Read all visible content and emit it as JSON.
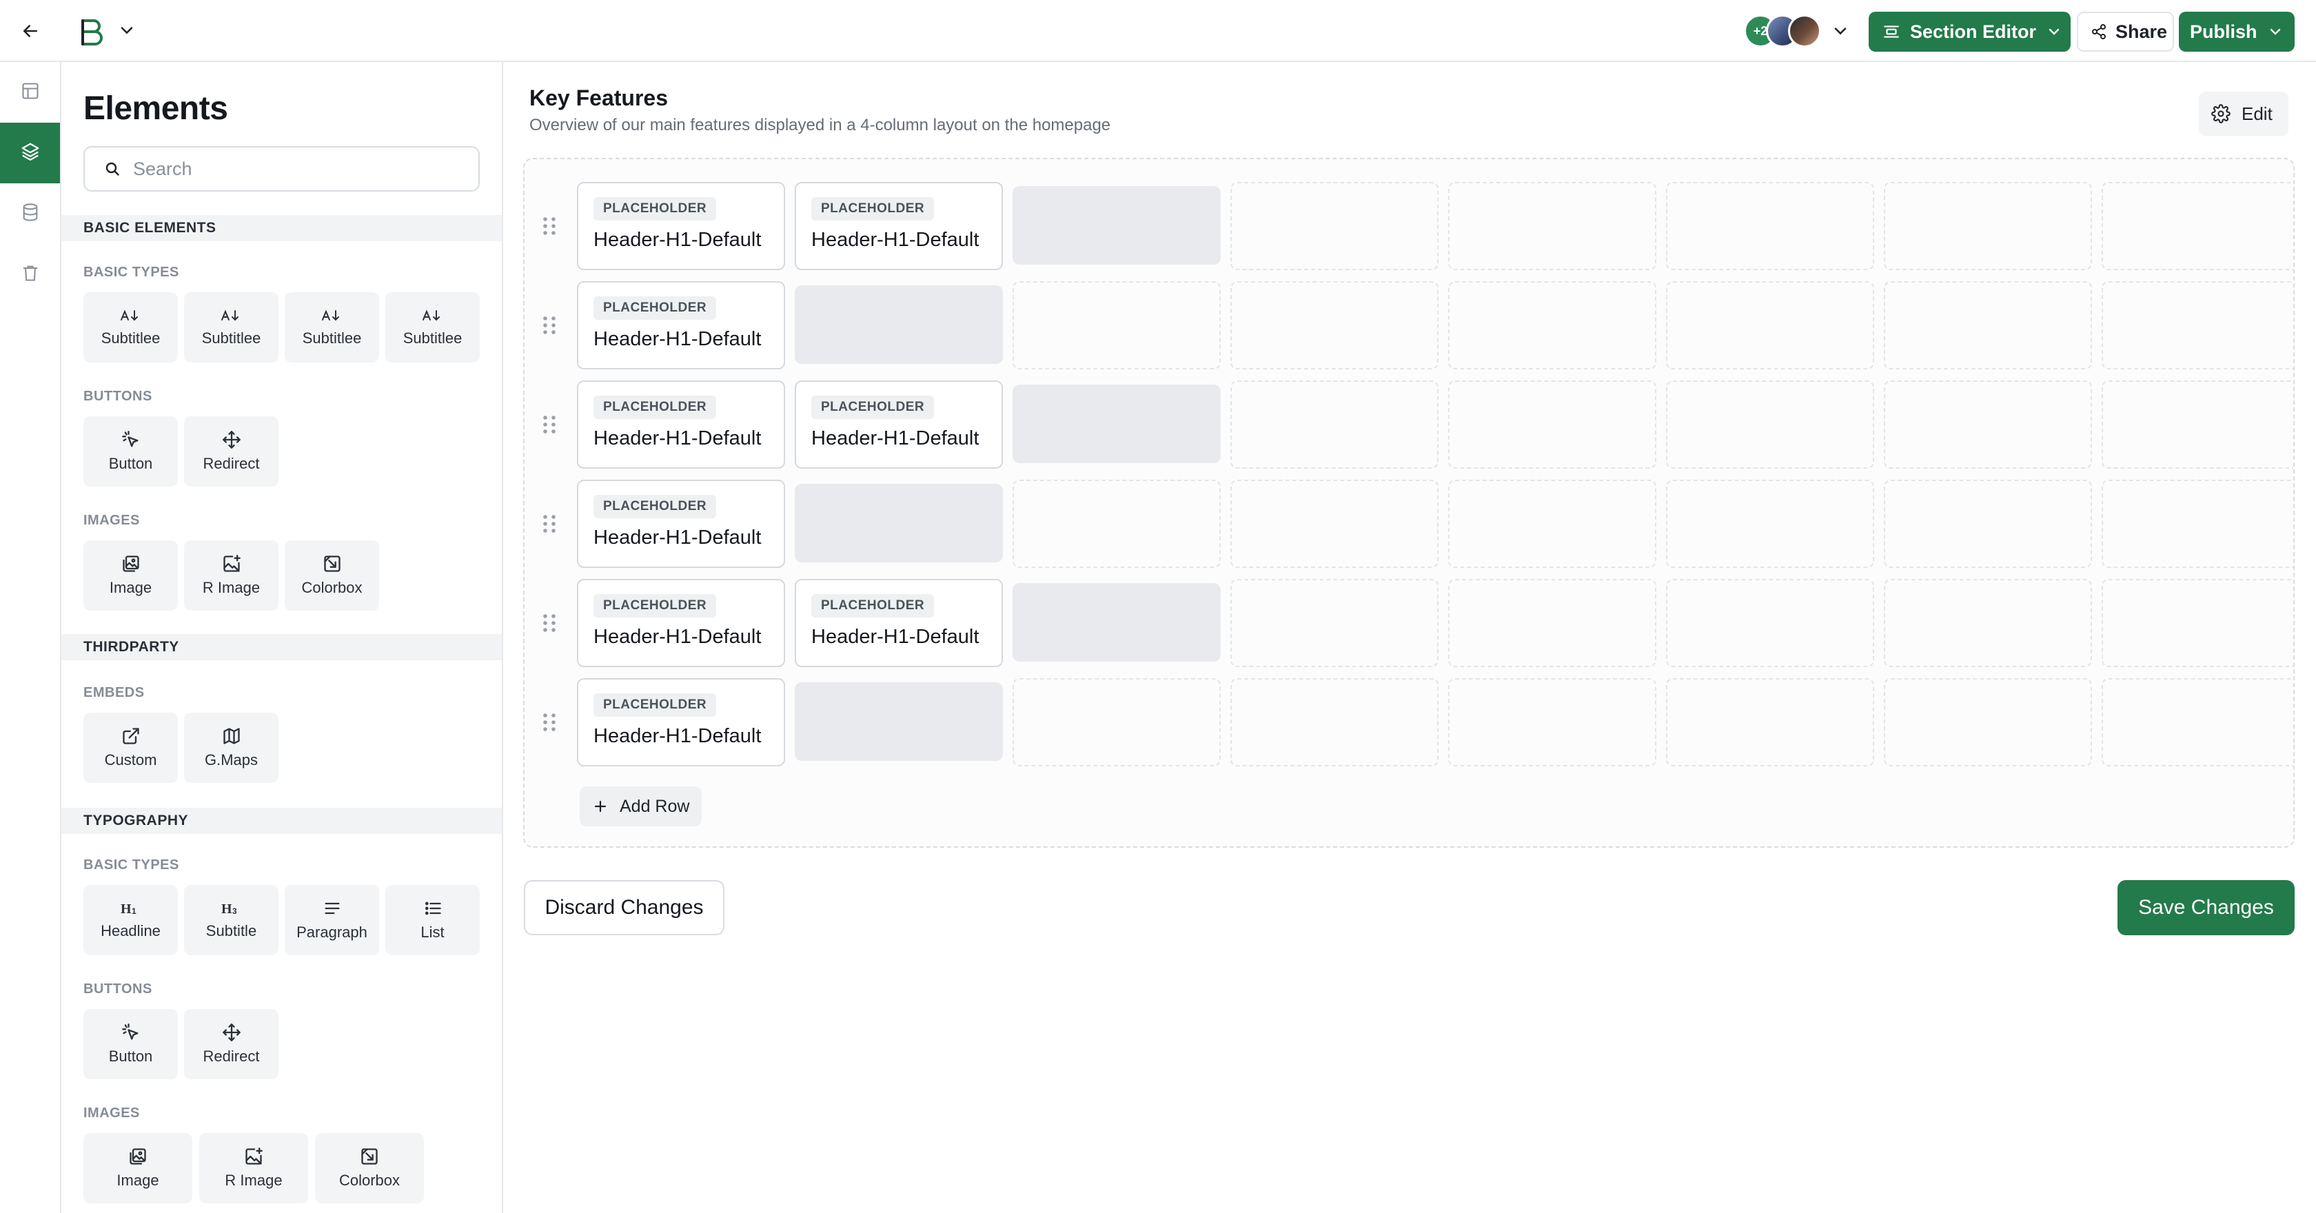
{
  "topbar": {
    "back_icon": "arrow-left-icon",
    "logo": "brand-logo",
    "collaborators": {
      "extra_count": "+2"
    },
    "section_editor_label": "Section Editor",
    "share_label": "Share",
    "publish_label": "Publish"
  },
  "rail": {
    "items": [
      {
        "icon": "layout-icon",
        "active": false
      },
      {
        "icon": "layers-icon",
        "active": true
      },
      {
        "icon": "database-icon",
        "active": false
      },
      {
        "icon": "trash-icon",
        "active": false
      }
    ]
  },
  "panel": {
    "title": "Elements",
    "search_placeholder": "Search",
    "sections": [
      {
        "label": "BASIC ELEMENTS",
        "groups": [
          {
            "label": "BASIC TYPES",
            "tiles": [
              "Subtitlee",
              "Subtitlee",
              "Subtitlee",
              "Subtitlee"
            ]
          },
          {
            "label": "BUTTONS",
            "tiles": [
              "Button",
              "Redirect"
            ]
          },
          {
            "label": "IMAGES",
            "tiles": [
              "Image",
              "R Image",
              "Colorbox"
            ]
          }
        ]
      },
      {
        "label": "THIRDPARTY",
        "groups": [
          {
            "label": "EMBEDS",
            "tiles": [
              "Custom",
              "G.Maps"
            ]
          }
        ]
      },
      {
        "label": "TYPOGRAPHY",
        "groups": [
          {
            "label": "BASIC TYPES",
            "tiles": [
              "Headline",
              "Subtitle",
              "Paragraph",
              "List"
            ]
          },
          {
            "label": "BUTTONS",
            "tiles": [
              "Button",
              "Redirect"
            ]
          },
          {
            "label": "IMAGES",
            "tiles": [
              "Image",
              "R Image",
              "Colorbox"
            ]
          }
        ]
      }
    ]
  },
  "main": {
    "title": "Key Features",
    "subtitle": "Overview of our main features displayed in a 4-column layout on the homepage",
    "edit_label": "Edit",
    "placeholder_tag": "PLACEHOLDER",
    "cell_title": "Header-H1-Default",
    "rows": [
      {
        "filled": 2
      },
      {
        "filled": 1
      },
      {
        "filled": 2
      },
      {
        "filled": 1
      },
      {
        "filled": 2
      },
      {
        "filled": 1
      }
    ],
    "add_row_label": "Add Row",
    "discard_label": "Discard Changes",
    "save_label": "Save Changes"
  },
  "colors": {
    "accent": "#237a4b",
    "muted_bg": "#f3f4f6",
    "empty_cell": "#e9eaed"
  }
}
